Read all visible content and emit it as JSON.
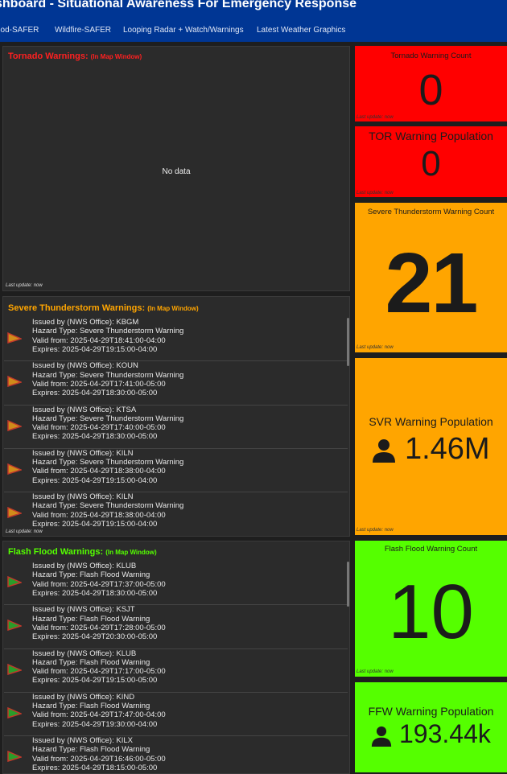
{
  "header": {
    "title": "shboard - Situational Awareness For Emergency Response",
    "nav": [
      "ood-SAFER",
      "Wildfire-SAFER",
      "Looping Radar + Watch/Warnings",
      "Latest Weather Graphics"
    ]
  },
  "colors": {
    "header": "#003694",
    "tornado": "#ff0000",
    "severe": "#ffa500",
    "flood": "#55ff00",
    "panel": "#2b2b2b"
  },
  "tornado_panel": {
    "title": "Tornado Warnings:",
    "subtitle": "(In Map Window)",
    "empty": "No data",
    "updated": "Last update: now"
  },
  "svr_panel": {
    "title": "Severe Thunderstorm Warnings:",
    "subtitle": "(In Map Window)",
    "updated": "Last update: now",
    "items": [
      {
        "office": "Issued by (NWS Office): KBGM",
        "hazard": "Hazard Type: Severe Thunderstorm Warning",
        "valid": "Valid from: 2025-04-29T18:41:00-04:00",
        "expires": "Expires: 2025-04-29T19:15:00-04:00"
      },
      {
        "office": "Issued by (NWS Office): KOUN",
        "hazard": "Hazard Type: Severe Thunderstorm Warning",
        "valid": "Valid from: 2025-04-29T17:41:00-05:00",
        "expires": "Expires: 2025-04-29T18:30:00-05:00"
      },
      {
        "office": "Issued by (NWS Office): KTSA",
        "hazard": "Hazard Type: Severe Thunderstorm Warning",
        "valid": "Valid from: 2025-04-29T17:40:00-05:00",
        "expires": "Expires: 2025-04-29T18:30:00-05:00"
      },
      {
        "office": "Issued by (NWS Office): KILN",
        "hazard": "Hazard Type: Severe Thunderstorm Warning",
        "valid": "Valid from: 2025-04-29T18:38:00-04:00",
        "expires": "Expires: 2025-04-29T19:15:00-04:00"
      },
      {
        "office": "Issued by (NWS Office): KILN",
        "hazard": "Hazard Type: Severe Thunderstorm Warning",
        "valid": "Valid from: 2025-04-29T18:38:00-04:00",
        "expires": "Expires: 2025-04-29T19:15:00-04:00"
      }
    ]
  },
  "ffw_panel": {
    "title": "Flash Flood Warnings:",
    "subtitle": "(In Map Window)",
    "items": [
      {
        "office": "Issued by (NWS Office): KLUB",
        "hazard": "Hazard Type: Flash Flood Warning",
        "valid": "Valid from: 2025-04-29T17:37:00-05:00",
        "expires": "Expires: 2025-04-29T18:30:00-05:00"
      },
      {
        "office": "Issued by (NWS Office): KSJT",
        "hazard": "Hazard Type: Flash Flood Warning",
        "valid": "Valid from: 2025-04-29T17:28:00-05:00",
        "expires": "Expires: 2025-04-29T20:30:00-05:00"
      },
      {
        "office": "Issued by (NWS Office): KLUB",
        "hazard": "Hazard Type: Flash Flood Warning",
        "valid": "Valid from: 2025-04-29T17:17:00-05:00",
        "expires": "Expires: 2025-04-29T19:15:00-05:00"
      },
      {
        "office": "Issued by (NWS Office): KIND",
        "hazard": "Hazard Type: Flash Flood Warning",
        "valid": "Valid from: 2025-04-29T17:47:00-04:00",
        "expires": "Expires: 2025-04-29T19:30:00-04:00"
      },
      {
        "office": "Issued by (NWS Office): KILX",
        "hazard": "Hazard Type: Flash Flood Warning",
        "valid": "Valid from: 2025-04-29T16:46:00-05:00",
        "expires": "Expires: 2025-04-29T18:15:00-05:00"
      }
    ]
  },
  "tiles": {
    "tor_count": {
      "title": "Tornado Warning Count",
      "value": "0",
      "updated": "Last update: now"
    },
    "tor_pop": {
      "title": "TOR Warning Population",
      "value": "0",
      "updated": "Last update: now"
    },
    "svr_count": {
      "title": "Severe Thunderstorm Warning Count",
      "value": "21",
      "updated": "Last update: now"
    },
    "svr_pop": {
      "title": "SVR Warning Population",
      "value": "1.46M",
      "icon": "person-icon",
      "updated": "Last update: now"
    },
    "ffw_count": {
      "title": "Flash Flood Warning Count",
      "value": "10",
      "updated": "Last update: now"
    },
    "ffw_pop": {
      "title": "FFW Warning Population",
      "value": "193.44k",
      "icon": "person-icon"
    }
  }
}
